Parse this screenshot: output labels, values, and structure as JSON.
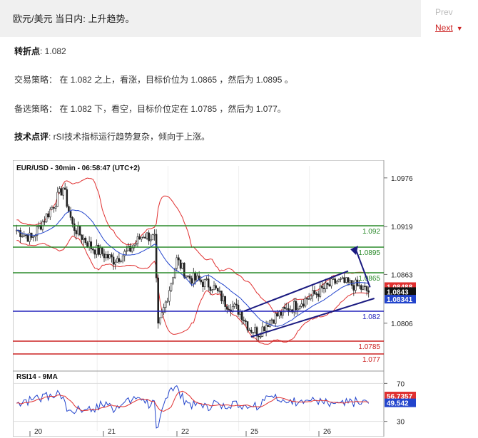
{
  "header": {
    "title": "欧元/美元 当日内: 上升趋势。"
  },
  "nav": {
    "prev": "Prev",
    "next": "Next"
  },
  "analysis": {
    "pivot_label": "转折点",
    "pivot_value": ": 1.082",
    "strategy": "交易策略： 在 1.082 之上，看涨，目标价位为 1.0865 ，然后为 1.0895 。",
    "alternative": "备选策略： 在 1.082 下，看空，目标价位定在 1.0785 ，然后为 1.077。",
    "comment_label": "技术点评",
    "comment_text": ": rSI技术指标运行趋势复杂，倾向于上涨。"
  },
  "chart_data": {
    "type": "candlestick",
    "title": "EUR/USD - 30min - 06:58:47 (UTC+2)",
    "ylim": [
      1.0755,
      1.099
    ],
    "y_ticks": [
      "1.0976",
      "1.0919",
      "1.0863",
      "1.0806"
    ],
    "x_ticks": [
      "20",
      "21",
      "22",
      "25",
      "26"
    ],
    "levels": [
      {
        "value": 1.092,
        "label": "1.092",
        "color": "#2a8a2a"
      },
      {
        "value": 1.0895,
        "label": "1.0895",
        "color": "#2a8a2a"
      },
      {
        "value": 1.0865,
        "label": "1.0865",
        "color": "#2a8a2a"
      },
      {
        "value": 1.082,
        "label": "1.082",
        "color": "#2222bb"
      },
      {
        "value": 1.0785,
        "label": "1.0785",
        "color": "#cc2222"
      },
      {
        "value": 1.077,
        "label": "1.077",
        "color": "#cc2222"
      }
    ],
    "badges": [
      {
        "value": 1.08488,
        "label": "1.08488",
        "color": "#e03030"
      },
      {
        "value": 1.0843,
        "label": "1.0843",
        "color": "#111111"
      },
      {
        "value": 1.08341,
        "label": "1.08341",
        "color": "#2244cc"
      }
    ],
    "rsi": {
      "title": "RSI14 - 9MA",
      "ylim": [
        20,
        80
      ],
      "y_ticks": [
        "70",
        "30"
      ],
      "badges": [
        {
          "value": 56.7357,
          "label": "56.7357",
          "color": "#e03030"
        },
        {
          "value": 49.542,
          "label": "49.542",
          "color": "#2244cc"
        }
      ]
    }
  }
}
